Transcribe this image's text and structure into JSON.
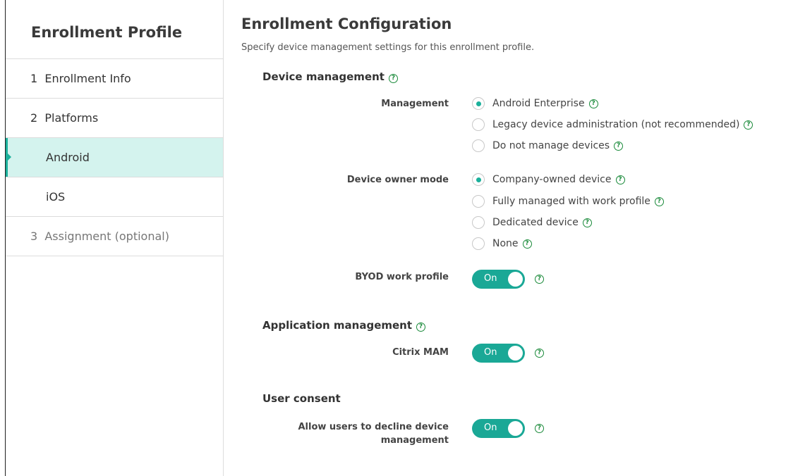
{
  "sidebar": {
    "title": "Enrollment Profile",
    "items": [
      {
        "label": "1  Enrollment Info"
      },
      {
        "label": "2  Platforms"
      },
      {
        "label": "Android"
      },
      {
        "label": "iOS"
      },
      {
        "label": "3  Assignment (optional)"
      }
    ],
    "active_item": "Android"
  },
  "main": {
    "title": "Enrollment Configuration",
    "subtitle": "Specify device management settings for this enrollment profile.",
    "sections": {
      "device_management": {
        "title": "Device management",
        "management": {
          "label": "Management",
          "options": [
            "Android Enterprise",
            "Legacy device administration (not recommended)",
            "Do not manage devices"
          ],
          "selected": "Android Enterprise"
        },
        "device_owner_mode": {
          "label": "Device owner mode",
          "options": [
            "Company-owned device",
            "Fully managed with work profile",
            "Dedicated device",
            "None"
          ],
          "selected": "Company-owned device"
        },
        "byod_work_profile": {
          "label": "BYOD work profile",
          "state": "On"
        }
      },
      "application_management": {
        "title": "Application management",
        "citrix_mam": {
          "label": "Citrix MAM",
          "state": "On"
        }
      },
      "user_consent": {
        "title": "User consent",
        "allow_decline": {
          "label": "Allow users to decline device management",
          "state": "On"
        }
      }
    }
  },
  "icons": {
    "help": "help-circle-icon",
    "help_glyph": "?"
  },
  "colors": {
    "accent": "#1bb09b",
    "toggle_on": "#1aa896",
    "active_nav_bg": "#d4f3ee",
    "help_icon": "#1a8a3a"
  }
}
